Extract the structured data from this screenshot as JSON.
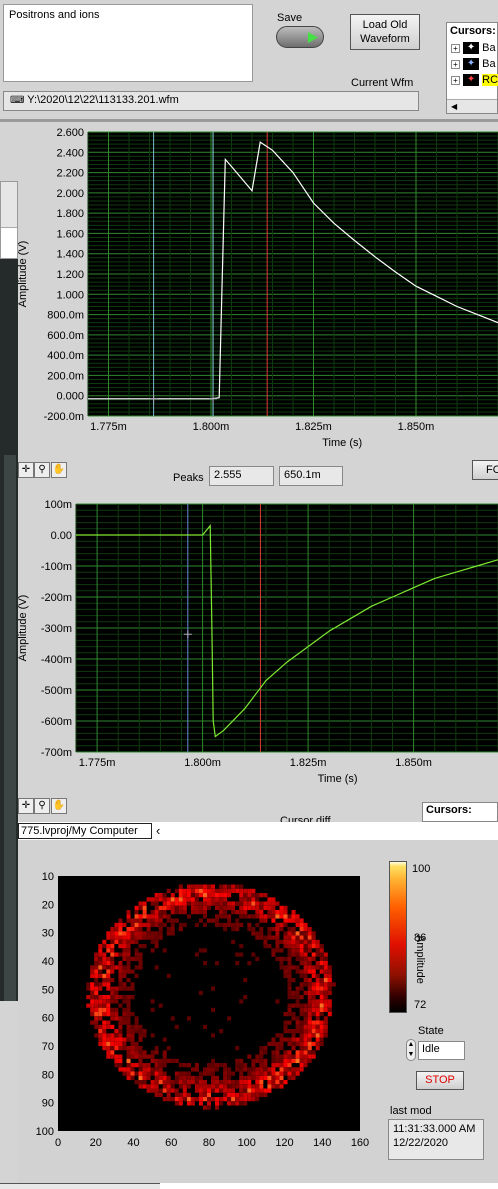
{
  "header": {
    "comment_text": "Positrons and ions",
    "save_label": "Save",
    "load_button_label": "Load Old Waveform",
    "current_wfm_label": "Current Wfm",
    "file_path": "Y:\\2020\\12\\22\\113133.201.wfm",
    "cursors_label": "Cursors:",
    "cursor_items": [
      "Ba",
      "Ba",
      "RC"
    ]
  },
  "chart1": {
    "y_title": "Amplitude (V)",
    "x_title": "Time (s)",
    "y_ticks": [
      "2.600",
      "2.400",
      "2.200",
      "2.000",
      "1.800",
      "1.600",
      "1.400",
      "1.200",
      "1.000",
      "800.0m",
      "600.0m",
      "400.0m",
      "200.0m",
      "0.000",
      "-200.0m"
    ],
    "x_ticks": [
      "1.775m",
      "1.800m",
      "1.825m",
      "1.850m"
    ]
  },
  "peaks_bar": {
    "label": "Peaks",
    "value1": "2.555",
    "value2": "650.1m",
    "right_button": "FO"
  },
  "chart2": {
    "y_title": "Amplitude (V)",
    "x_title": "Time (s)",
    "y_ticks": [
      "100m",
      "0.00",
      "-100m",
      "-200m",
      "-300m",
      "-400m",
      "-500m",
      "-600m",
      "-700m"
    ],
    "x_ticks": [
      "1.775m",
      "1.800m",
      "1.825m",
      "1.850m"
    ]
  },
  "lower_bar": {
    "cursor_diff_label": "Cursor diff",
    "cursors_label": "Cursors:"
  },
  "project_path": "775.lvproj/My Computer",
  "heatmap": {
    "y_ticks": [
      "10",
      "20",
      "30",
      "40",
      "50",
      "60",
      "70",
      "80",
      "90",
      "100"
    ],
    "x_ticks": [
      "0",
      "20",
      "40",
      "60",
      "80",
      "100",
      "120",
      "140",
      "160"
    ],
    "scale_ticks": [
      "100",
      "86",
      "72"
    ],
    "scale_title": "Amplitude"
  },
  "state": {
    "label": "State",
    "value": "Idle",
    "stop_label": "STOP"
  },
  "last_mod": {
    "label": "last mod",
    "time": "11:31:33.000 AM",
    "date": "12/22/2020"
  },
  "chart_data": [
    {
      "type": "line",
      "xlabel": "Time (s)",
      "ylabel": "Amplitude (V)",
      "xlim": [
        0.00177,
        0.00187
      ],
      "ylim": [
        -0.2,
        2.6
      ],
      "grid": true,
      "series": [
        {
          "x": [
            0.00177,
            0.0018,
            0.001802,
            0.0018025,
            0.0018035,
            0.001805,
            0.00181,
            0.001812,
            0.001815,
            0.00182,
            0.001825,
            0.00183,
            0.001835,
            0.00184,
            0.001845,
            0.00185,
            0.001855,
            0.00186,
            0.001865,
            0.00187
          ],
          "y": [
            -0.03,
            -0.03,
            -0.02,
            0.8,
            2.33,
            2.26,
            2.02,
            2.5,
            2.42,
            2.2,
            1.9,
            1.7,
            1.53,
            1.37,
            1.22,
            1.08,
            0.98,
            0.88,
            0.8,
            0.72
          ]
        }
      ],
      "cursors_x": [
        0.001786,
        0.0018005,
        0.0018137
      ]
    },
    {
      "type": "line",
      "xlabel": "Time (s)",
      "ylabel": "Amplitude (V)",
      "xlim": [
        0.00177,
        0.00187
      ],
      "ylim": [
        -0.7,
        0.1
      ],
      "grid": true,
      "series": [
        {
          "x": [
            0.00177,
            0.0018,
            0.0018018,
            0.0018022,
            0.0018025,
            0.001803,
            0.001805,
            0.00181,
            0.001815,
            0.00182,
            0.001825,
            0.00183,
            0.001835,
            0.00184,
            0.001845,
            0.00185,
            0.001855,
            0.00186,
            0.001865,
            0.00187
          ],
          "y": [
            0.0,
            0.0,
            0.03,
            -0.3,
            -0.6,
            -0.65,
            -0.63,
            -0.56,
            -0.47,
            -0.41,
            -0.36,
            -0.31,
            -0.27,
            -0.23,
            -0.2,
            -0.17,
            -0.14,
            -0.12,
            -0.1,
            -0.08
          ]
        }
      ],
      "cursors_x": [
        0.0017965,
        0.0018137
      ]
    },
    {
      "type": "heatmap",
      "xlim": [
        0,
        160
      ],
      "ylim": [
        100,
        10
      ],
      "colorbar_range": [
        72,
        100
      ],
      "colorbar_label": "Amplitude"
    }
  ]
}
